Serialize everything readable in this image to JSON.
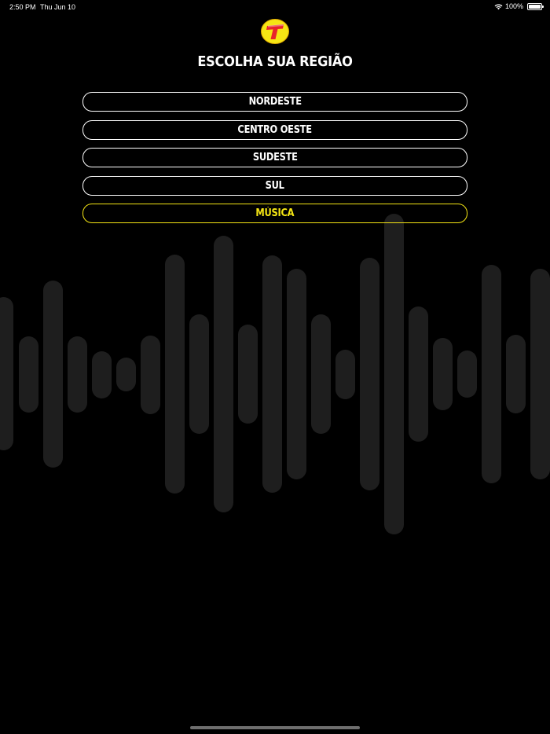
{
  "status_bar": {
    "time": "2:50 PM",
    "date": "Thu Jun 10",
    "battery": "100%",
    "icons": [
      "wifi-icon",
      "battery-icon"
    ]
  },
  "header": {
    "logo_icon": "transamerica-t-logo",
    "title": "ESCOLHA SUA REGIÃO"
  },
  "regions": [
    {
      "label": "NORDESTE"
    },
    {
      "label": "CENTRO OESTE"
    },
    {
      "label": "SUDESTE"
    },
    {
      "label": "SUL"
    },
    {
      "label": "MÚSICA"
    }
  ],
  "colors": {
    "background": "#000000",
    "text": "#ffffff",
    "accent": "#f5e614",
    "waveform": "#1e1e1e"
  }
}
